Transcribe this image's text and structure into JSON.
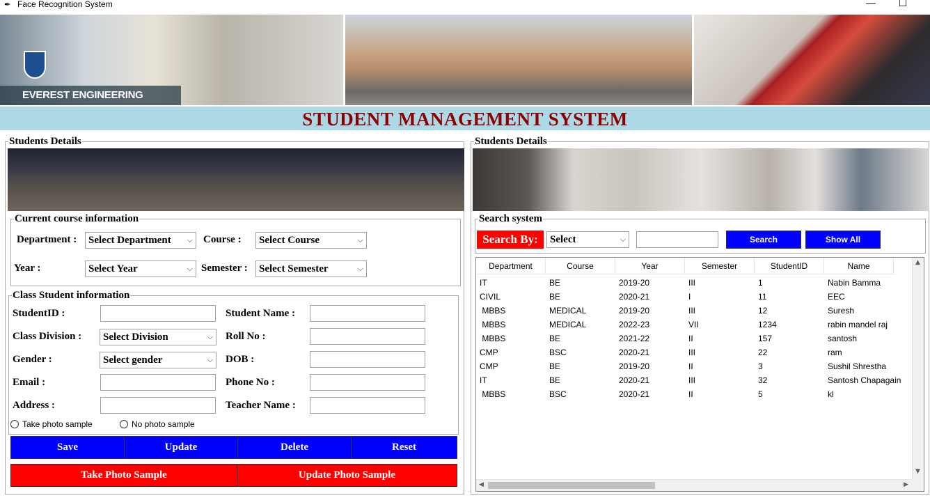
{
  "window": {
    "title": "Face Recognition System",
    "minimize_glyph": "—",
    "maximize_glyph": "☐"
  },
  "banner": {
    "college_name": "EVEREST ENGINEERING COLLEGE"
  },
  "header": {
    "title": "STUDENT MANAGEMENT SYSTEM"
  },
  "left_frame": {
    "label": "Students Details",
    "course_info": {
      "label": "Current course information",
      "department_label": "Department :",
      "department_value": "Select Department",
      "course_label": "Course :",
      "course_value": "Select Course",
      "year_label": "Year :",
      "year_value": "Select Year",
      "semester_label": "Semester :",
      "semester_value": "Select Semester"
    },
    "class_info": {
      "label": "Class Student information",
      "student_id_label": "StudentID :",
      "student_name_label": "Student Name :",
      "class_division_label": "Class Division :",
      "class_division_value": "Select Division",
      "roll_no_label": "Roll No :",
      "gender_label": "Gender :",
      "gender_value": "Select gender",
      "dob_label": "DOB :",
      "email_label": "Email :",
      "phone_label": "Phone No :",
      "address_label": "Address :",
      "teacher_label": "Teacher Name :",
      "radio_take": "Take photo sample",
      "radio_none": "No photo sample"
    },
    "buttons": {
      "save": "Save",
      "update": "Update",
      "delete": "Delete",
      "reset": "Reset",
      "take_photo": "Take Photo Sample",
      "update_photo": "Update Photo Sample"
    }
  },
  "right_frame": {
    "label": "Students Details",
    "search": {
      "label": "Search system",
      "search_by": "Search By:",
      "select_value": "Select",
      "search_button": "Search",
      "show_all_button": "Show All"
    },
    "table": {
      "columns": [
        "Department",
        "Course",
        "Year",
        "Semester",
        "StudentID",
        "Name"
      ],
      "rows": [
        [
          "IT",
          "BE",
          "2019-20",
          "III",
          "1",
          "Nabin Bamma"
        ],
        [
          "CIVIL",
          "BE",
          "2020-21",
          "I",
          "11",
          "EEC"
        ],
        [
          " MBBS",
          "MEDICAL",
          "2019-20",
          "III",
          "12",
          "Suresh"
        ],
        [
          " MBBS",
          "MEDICAL",
          "2022-23",
          "VII",
          "1234",
          "rabin mandel raj"
        ],
        [
          " MBBS",
          "BE",
          "2021-22",
          "II",
          "157",
          "santosh"
        ],
        [
          "CMP",
          "BSC",
          "2020-21",
          "III",
          "22",
          "ram"
        ],
        [
          "CMP",
          "BE",
          "2019-20",
          "II",
          "3",
          "Sushil Shrestha"
        ],
        [
          "IT",
          "BE",
          "2020-21",
          "III",
          "32",
          "Santosh Chapagain"
        ],
        [
          " MBBS",
          "BSC",
          "2020-21",
          "II",
          "5",
          "kl"
        ]
      ]
    }
  },
  "icons": {
    "app": "feather-icon",
    "combo": "chevron-down-icon"
  }
}
